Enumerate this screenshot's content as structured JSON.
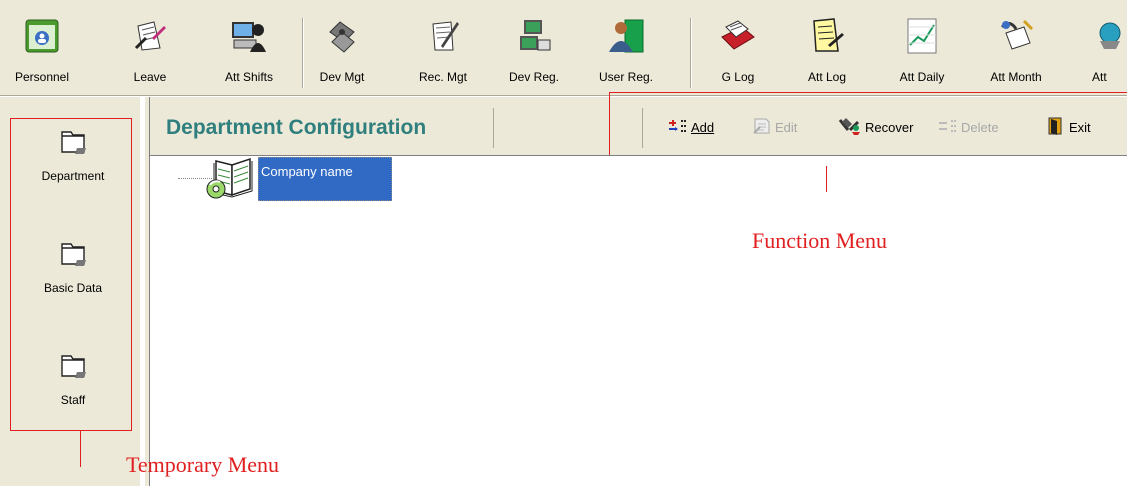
{
  "toolbar": {
    "items": [
      {
        "label": "Personnel",
        "icon": "personnel-icon"
      },
      {
        "label": "Leave",
        "icon": "leave-icon"
      },
      {
        "label": "Att Shifts",
        "icon": "att-shifts-icon"
      },
      {
        "label": "Dev Mgt",
        "icon": "dev-mgt-icon"
      },
      {
        "label": "Rec. Mgt",
        "icon": "rec-mgt-icon"
      },
      {
        "label": "Dev Reg.",
        "icon": "dev-reg-icon"
      },
      {
        "label": "User Reg.",
        "icon": "user-reg-icon"
      },
      {
        "label": "G Log",
        "icon": "g-log-icon"
      },
      {
        "label": "Att Log",
        "icon": "att-log-icon"
      },
      {
        "label": "Att Daily",
        "icon": "att-daily-icon"
      },
      {
        "label": "Att Month",
        "icon": "att-month-icon"
      },
      {
        "label": "Att",
        "icon": "att-icon"
      }
    ]
  },
  "temp_menu": {
    "items": [
      {
        "label": "Department",
        "icon": "folder-icon"
      },
      {
        "label": "Basic Data",
        "icon": "folder-icon"
      },
      {
        "label": "Staff",
        "icon": "folder-icon"
      }
    ]
  },
  "header": {
    "title": "Department Configuration"
  },
  "function_menu": {
    "add": "Add",
    "edit": "Edit",
    "recover": "Recover",
    "delete": "Delete",
    "exit": "Exit"
  },
  "tree": {
    "root_label": "Company name"
  },
  "annotations": {
    "function_menu": "Function Menu",
    "temporary_menu": "Temporary Menu"
  },
  "colors": {
    "title": "#2f7f7e",
    "annotation": "#e02020",
    "selection": "#316ac5",
    "panel": "#ece9d8"
  }
}
